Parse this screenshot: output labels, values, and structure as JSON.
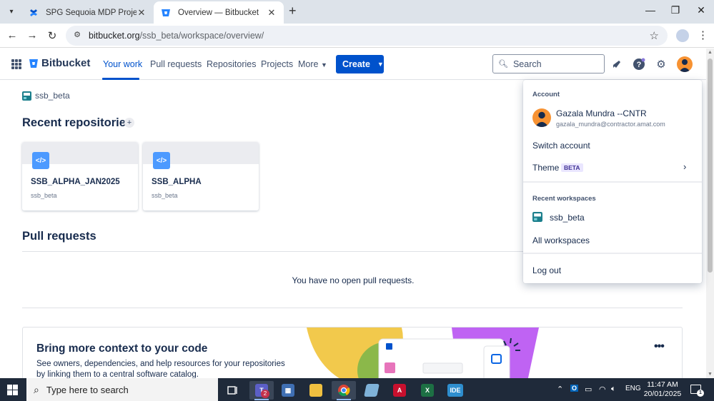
{
  "browser": {
    "tabs": [
      {
        "title": "SPG Sequoia MDP Projects - Te",
        "active": false
      },
      {
        "title": "Overview — Bitbucket",
        "active": true
      }
    ],
    "new_tab_icon": "plus-icon",
    "url_host": "bitbucket.org",
    "url_path": "/ssb_beta/workspace/overview/"
  },
  "header": {
    "product_name": "Bitbucket",
    "nav": [
      "Your work",
      "Pull requests",
      "Repositories",
      "Projects",
      "More"
    ],
    "active_nav": "Your work",
    "create_label": "Create",
    "search_placeholder": "Search",
    "brand_color": "#0052cc"
  },
  "main": {
    "workspace_name": "ssb_beta",
    "recent_repos_title": "Recent repositories",
    "repos": [
      {
        "name": "SSB_ALPHA_JAN2025",
        "workspace": "ssb_beta"
      },
      {
        "name": "SSB_ALPHA",
        "workspace": "ssb_beta"
      }
    ],
    "pull_requests_title": "Pull requests",
    "pull_requests_empty": "You have no open pull requests.",
    "promo": {
      "title": "Bring more context to your code",
      "description": "See owners, dependencies, and help resources for your repositories by linking them to a central software catalog.",
      "menu_icon": "more-icon"
    }
  },
  "account_menu": {
    "account_heading": "Account",
    "user_name": "Gazala Mundra --CNTR",
    "user_email": "gazala_mundra@contractor.amat.com",
    "switch_account": "Switch account",
    "theme_label": "Theme",
    "theme_badge": "BETA",
    "recent_workspaces_heading": "Recent workspaces",
    "workspace": "ssb_beta",
    "all_workspaces": "All workspaces",
    "logout": "Log out"
  },
  "taskbar": {
    "search_placeholder": "Type here to search",
    "teams_badge": "2",
    "ide_label": "IDE",
    "language": "ENG",
    "time": "11:47 AM",
    "date": "20/01/2025",
    "notification_count": "1"
  }
}
